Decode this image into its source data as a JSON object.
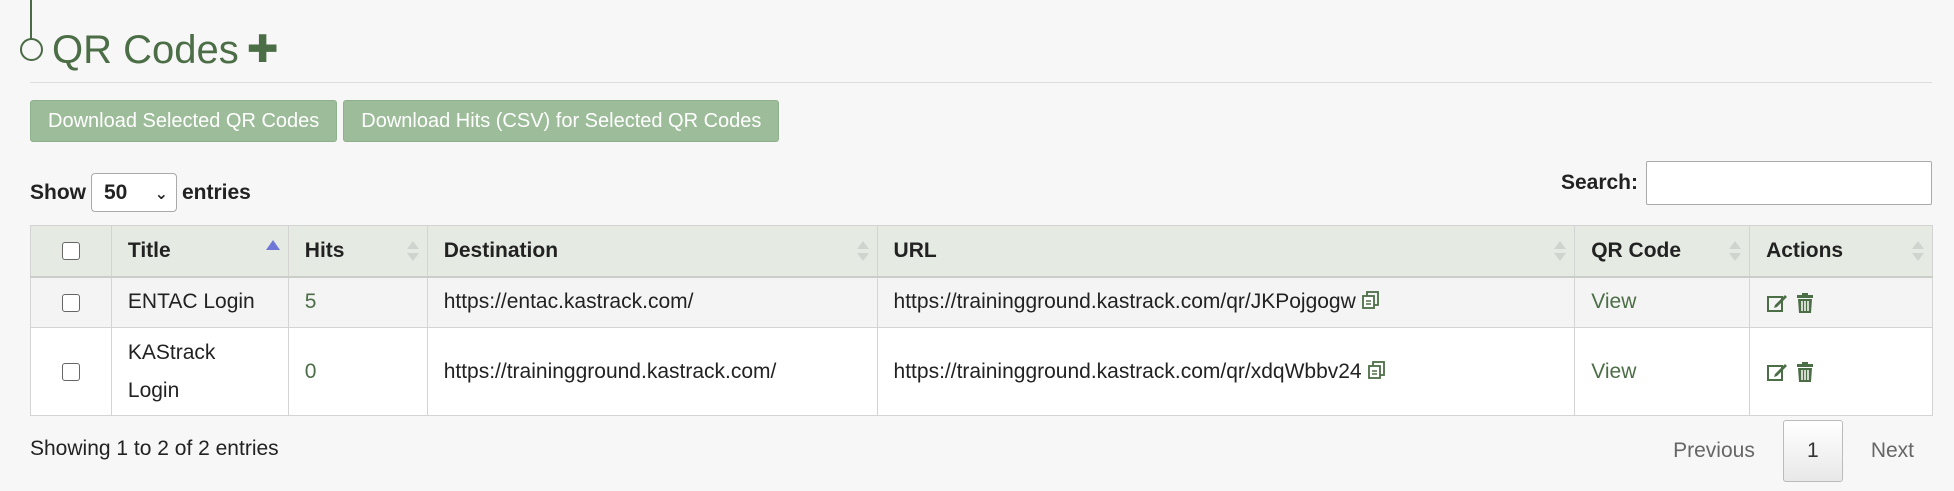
{
  "header": {
    "title": "QR Codes",
    "add_icon": "plus-icon"
  },
  "actions": {
    "download_selected": "Download Selected QR Codes",
    "download_hits_csv": "Download Hits (CSV) for Selected QR Codes"
  },
  "length": {
    "show": "Show",
    "value": "50",
    "entries": "entries"
  },
  "search": {
    "label": "Search:",
    "value": ""
  },
  "table": {
    "columns": [
      "Title",
      "Hits",
      "Destination",
      "URL",
      "QR Code",
      "Actions"
    ],
    "rows": [
      {
        "title": "ENTAC Login",
        "hits": "5",
        "destination": "https://entac.kastrack.com/",
        "url": "https://trainingground.kastrack.com/qr/JKPojgogw",
        "qr_code": "View"
      },
      {
        "title": "KAStrack Login",
        "hits": "0",
        "destination": "https://trainingground.kastrack.com/",
        "url": "https://trainingground.kastrack.com/qr/xdqWbbv24",
        "qr_code": "View"
      }
    ]
  },
  "footer": {
    "info": "Showing 1 to 2 of 2 entries",
    "previous": "Previous",
    "current_page": "1",
    "next": "Next"
  },
  "colors": {
    "accent": "#4c6e46",
    "button_bg": "#9dbc9a",
    "header_bg": "#e5ebe3"
  }
}
